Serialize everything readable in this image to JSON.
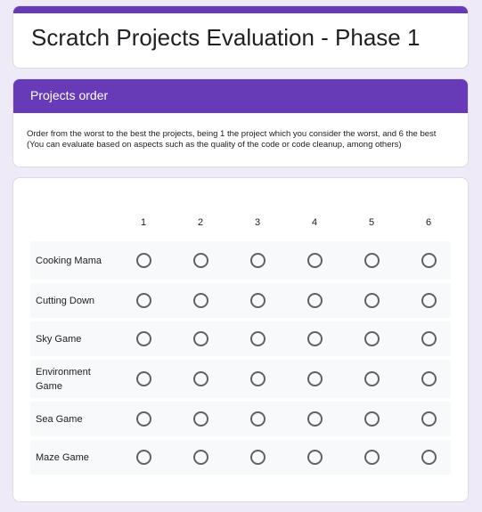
{
  "form": {
    "title": "Scratch Projects Evaluation - Phase 1",
    "accent_color": "#673ab7",
    "background_color": "#efeaf8"
  },
  "section": {
    "title": "Projects order",
    "description": "Order from the worst to the best the projects, being 1 the project which you consider the worst, and 6 the best (You can evaluate based on aspects such as the quality of the code or code cleanup, among others)"
  },
  "grid": {
    "columns": [
      "1",
      "2",
      "3",
      "4",
      "5",
      "6"
    ],
    "rows": [
      {
        "label": "Cooking Mama",
        "selected": null
      },
      {
        "label": "Cutting Down",
        "selected": null
      },
      {
        "label": "Sky Game",
        "selected": null
      },
      {
        "label": "Environment Game",
        "selected": null
      },
      {
        "label": "Sea Game",
        "selected": null
      },
      {
        "label": "Maze Game",
        "selected": null
      }
    ]
  }
}
